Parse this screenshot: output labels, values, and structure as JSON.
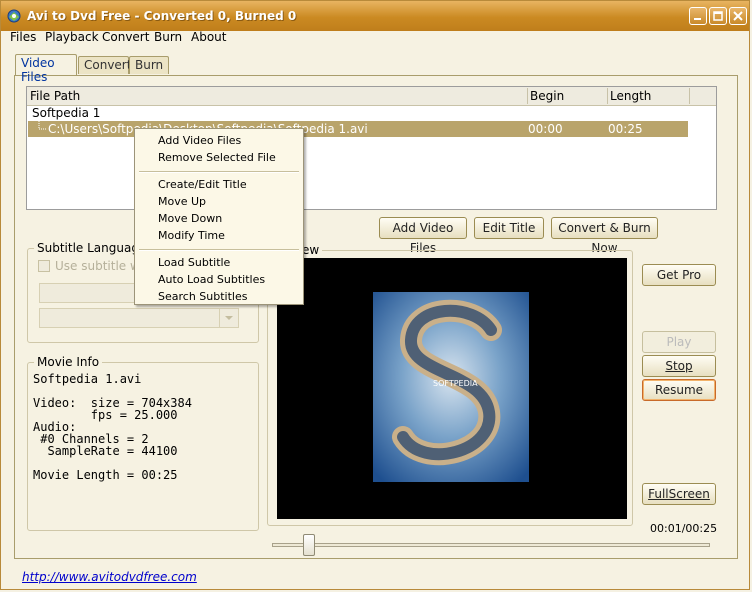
{
  "window": {
    "title": "Avi to Dvd Free - Converted 0, Burned 0",
    "controls": {
      "minimize": "minimize-icon",
      "maximize": "maximize-icon",
      "close": "close-icon"
    }
  },
  "menu": [
    "Files",
    "Playback",
    "Convert",
    "Burn",
    "About"
  ],
  "tabs": [
    {
      "label": "Video Files",
      "active": true
    },
    {
      "label": "Convert",
      "active": false
    },
    {
      "label": "Burn",
      "active": false
    }
  ],
  "file_list": {
    "columns": [
      "File Path",
      "Begin",
      "Length"
    ],
    "group": "Softpedia 1",
    "selected_row": {
      "path": "C:\\Users\\Softpedia\\Desktop\\Softpedia\\Softpedia 1.avi",
      "begin": "00:00",
      "length": "00:25"
    }
  },
  "buttons": {
    "add_video_files": "Add Video Files",
    "edit_title": "Edit Title",
    "convert_burn_now": "Convert & Burn Now",
    "get_pro": "Get Pro",
    "play": "Play",
    "stop": "Stop",
    "resume": "Resume",
    "fullscreen": "FullScreen"
  },
  "context_menu": {
    "items": [
      "Add Video Files",
      "Remove Selected File",
      "Create/Edit Title",
      "Move Up",
      "Move Down",
      "Modify Time",
      "Load Subtitle",
      "Auto Load Subtitles",
      "Search Subtitles"
    ]
  },
  "subtitle": {
    "group_label": "Subtitle Language",
    "checkbox_label": "Use subtitle while",
    "checked": false
  },
  "preview": {
    "group_label": "ew",
    "time": "00:01/00:25",
    "position_fraction": 0.04,
    "watermark": "SOFTPEDIA"
  },
  "movie_info": {
    "group_label": "Movie Info",
    "lines": [
      "Softpedia 1.avi",
      "",
      "Video:  size = 704x384",
      "        fps = 25.000",
      "Audio:",
      " #0 Channels = 2",
      "  SampleRate = 44100",
      "",
      "Movie Length = 00:25"
    ]
  },
  "footer": {
    "link": "http://www.avitodvdfree.com"
  },
  "colors": {
    "title_bar": "#c98a22",
    "selection": "#b9a46b",
    "background": "#f6f2e2",
    "video_bg": "#000000"
  }
}
